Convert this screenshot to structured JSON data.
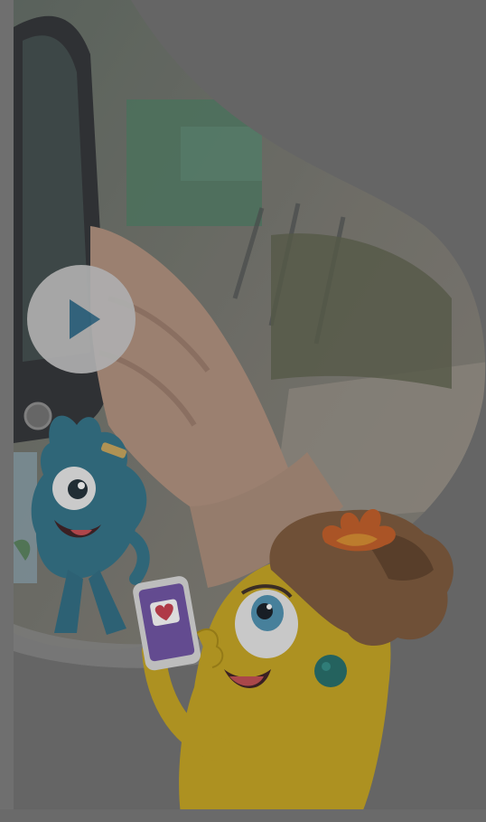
{
  "hero": {
    "play_icon": "play-icon",
    "accent_color": "#2f6e8f",
    "overlay_color": "#6e6e6e"
  }
}
